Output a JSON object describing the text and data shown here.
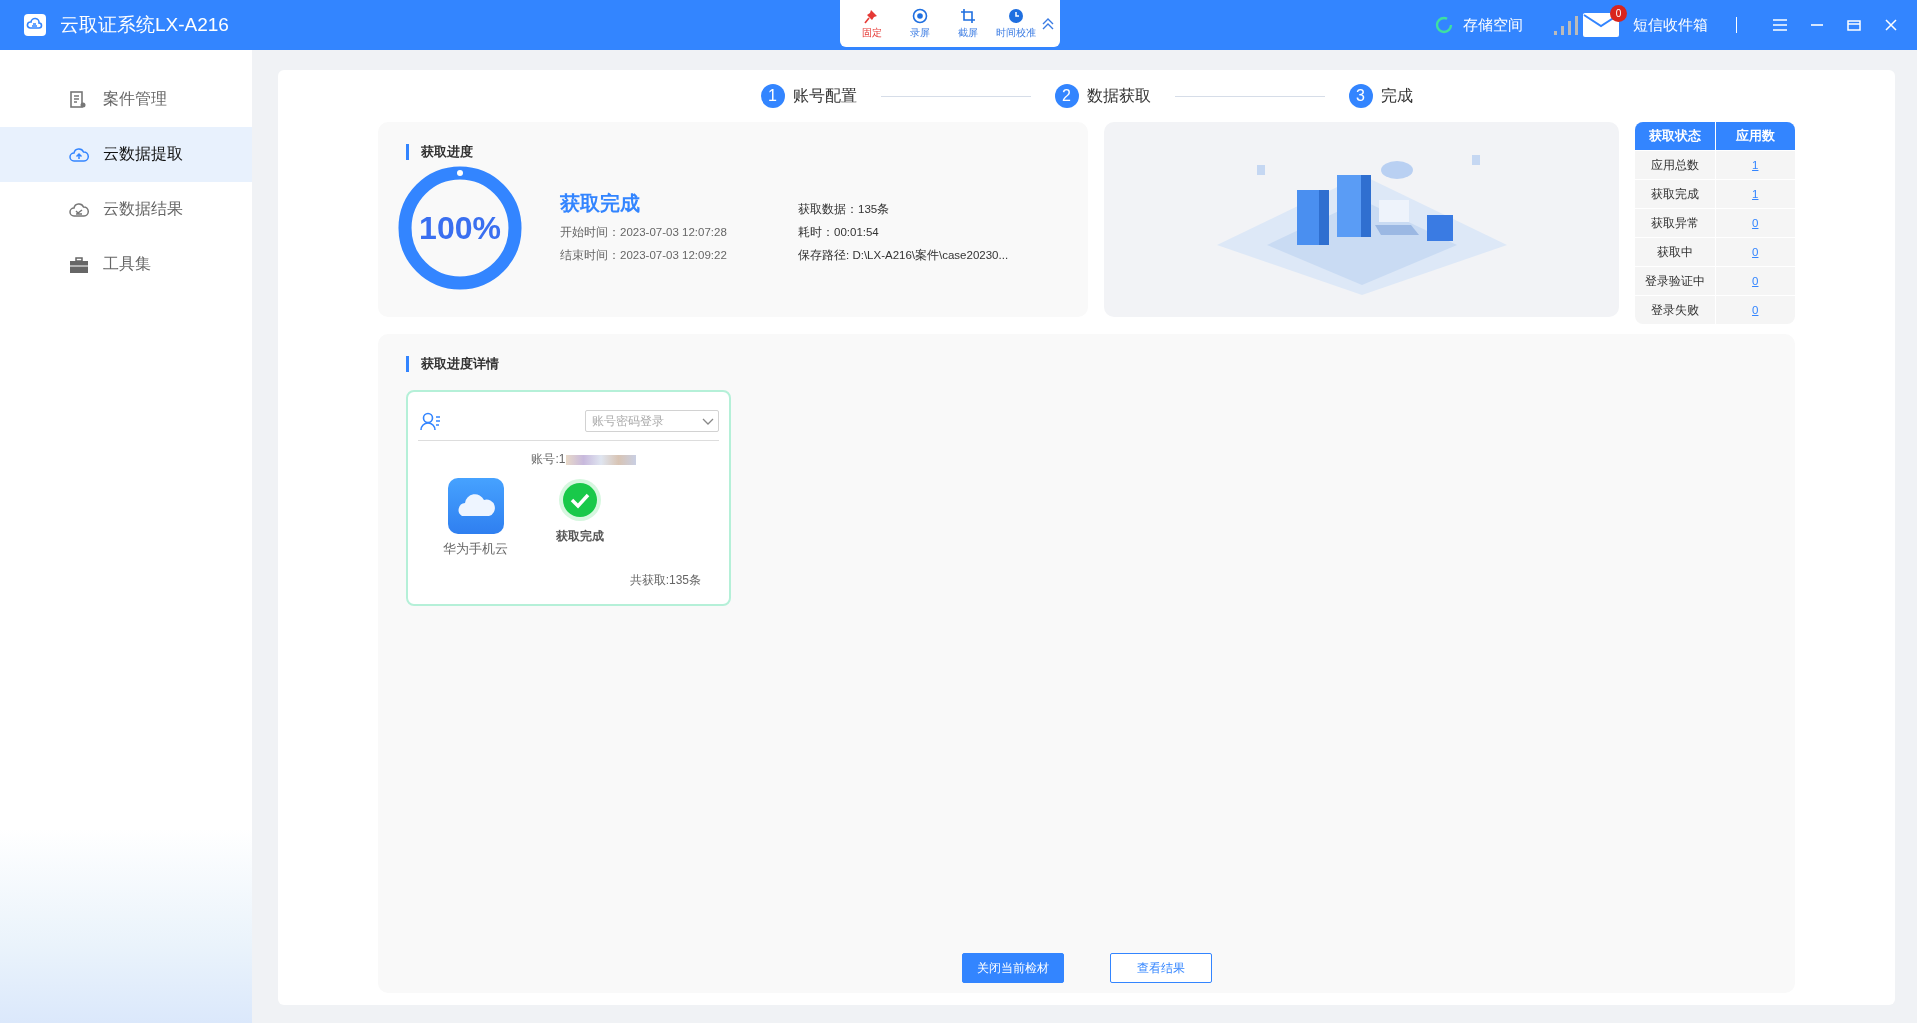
{
  "app": {
    "title": "云取证系统LX-A216"
  },
  "toolbar": [
    {
      "label": "固定",
      "kind": "pin"
    },
    {
      "label": "录屏",
      "kind": "record"
    },
    {
      "label": "截屏",
      "kind": "crop"
    },
    {
      "label": "时间校准",
      "kind": "clock"
    }
  ],
  "header_right": {
    "storage": "存储空间",
    "sms_badge": "0",
    "sms": "短信收件箱"
  },
  "sidebar": {
    "items": [
      {
        "label": "案件管理",
        "kind": "case",
        "selected": false
      },
      {
        "label": "云数据提取",
        "kind": "upload",
        "selected": true
      },
      {
        "label": "云数据结果",
        "kind": "result",
        "selected": false
      },
      {
        "label": "工具集",
        "kind": "tools",
        "selected": false
      }
    ]
  },
  "steps": [
    {
      "number": "1",
      "label": "账号配置"
    },
    {
      "number": "2",
      "label": "数据获取"
    },
    {
      "number": "3",
      "label": "完成"
    }
  ],
  "progress": {
    "title": "获取进度",
    "level": 1,
    "percent": "100%",
    "status": "获取完成",
    "start": "开始时间：2023-07-03 12:07:28",
    "end": "结束时间：2023-07-03 12:09:22",
    "count": "获取数据：135条",
    "duration": "耗时：00:01:54",
    "path": "保存路径: D:\\LX-A216\\案件\\case20230..."
  },
  "status_table": {
    "columns": [
      "获取状态",
      "应用数"
    ],
    "rows": [
      {
        "label": "应用总数",
        "count": "1"
      },
      {
        "label": "获取完成",
        "count": "1"
      },
      {
        "label": "获取异常",
        "count": "0"
      },
      {
        "label": "获取中",
        "count": "0"
      },
      {
        "label": "登录验证中",
        "count": "0"
      },
      {
        "label": "登录失败",
        "count": "0"
      }
    ]
  },
  "details": {
    "title": "获取进度详情",
    "cards": [
      {
        "login_mode": {
          "placeholder": "账号密码登录"
        },
        "account": "账号:1",
        "app": "华为手机云",
        "status": "获取完成",
        "total": "共获取:135条"
      }
    ]
  },
  "buttons": [
    {
      "label": "关闭当前检材",
      "kind": "primary"
    },
    {
      "label": "查看结果",
      "kind": "outline"
    }
  ]
}
